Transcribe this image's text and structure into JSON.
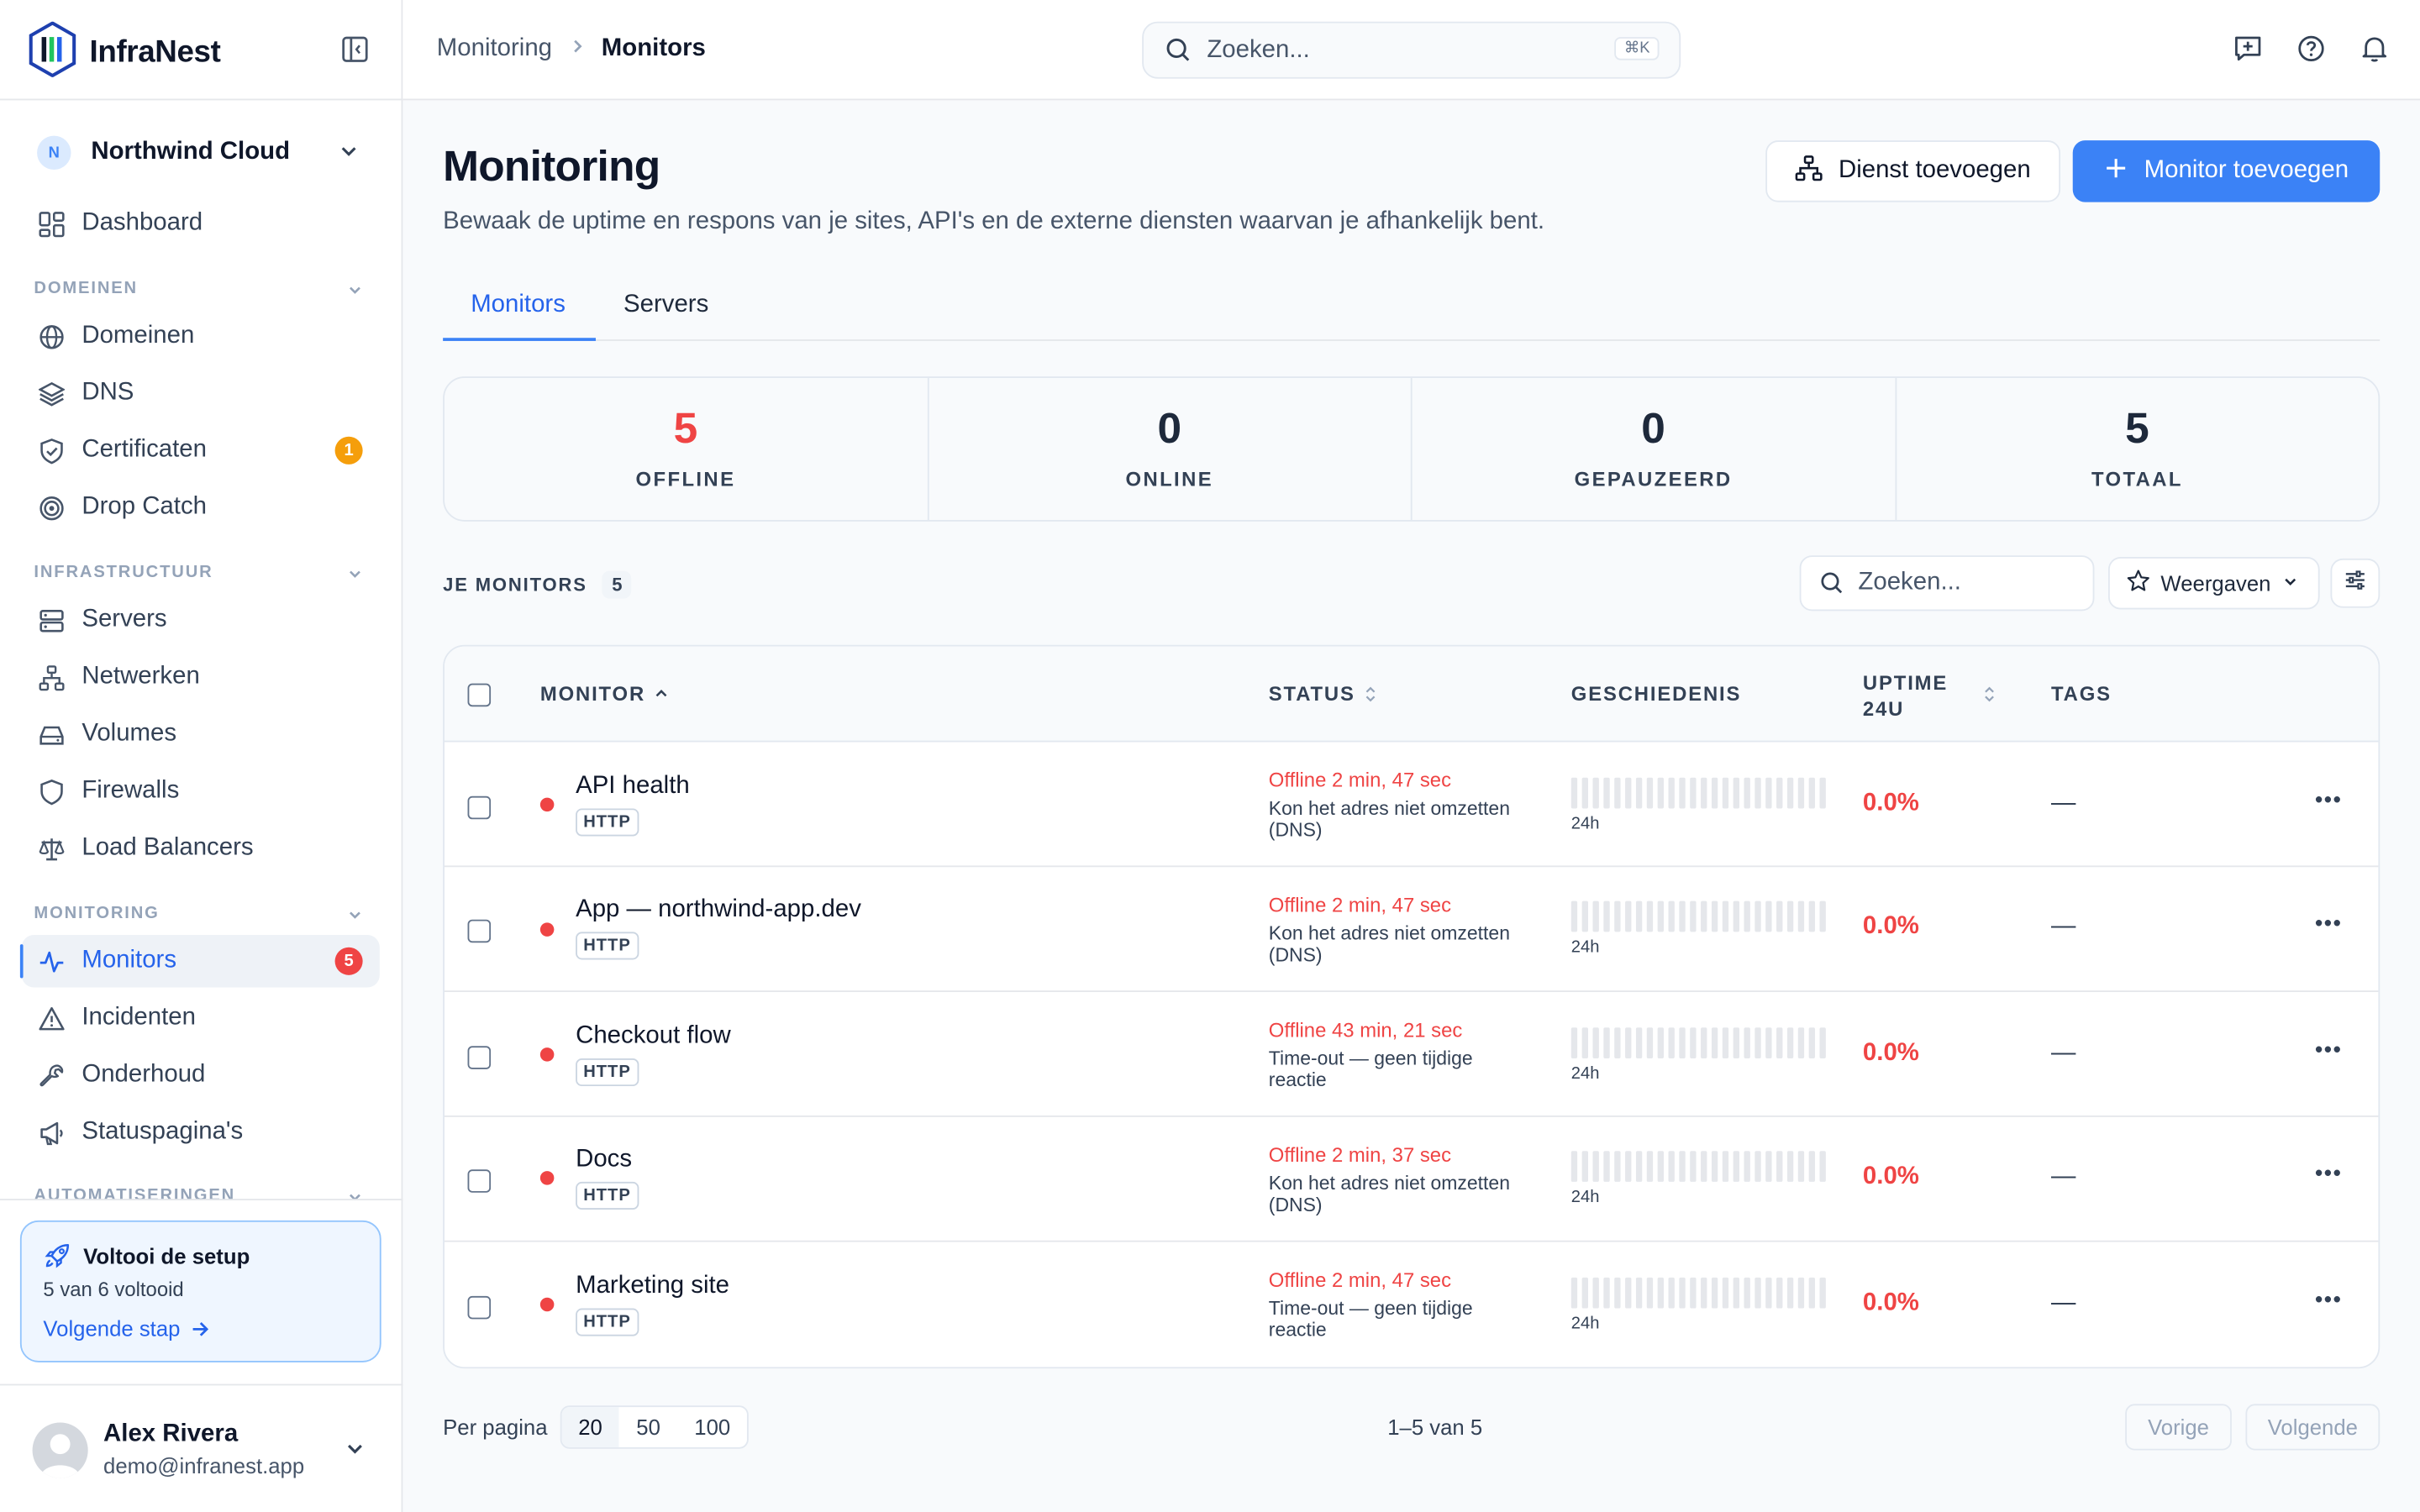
{
  "app": {
    "name": "InfraNest"
  },
  "workspace": {
    "initial": "N",
    "name": "Northwind Cloud"
  },
  "nav": {
    "dashboard": "Dashboard",
    "domains_section": "DOMEINEN",
    "domains": "Domeinen",
    "dns": "DNS",
    "certificates": "Certificaten",
    "certificates_badge": "1",
    "drop_catch": "Drop Catch",
    "infra_section": "INFRASTRUCTUUR",
    "servers": "Servers",
    "networks": "Netwerken",
    "volumes": "Volumes",
    "firewalls": "Firewalls",
    "load_balancers": "Load Balancers",
    "monitoring_section": "MONITORING",
    "monitors": "Monitors",
    "monitors_badge": "5",
    "incidents": "Incidenten",
    "maintenance": "Onderhoud",
    "status_pages": "Statuspagina's",
    "automations_section": "AUTOMATISERINGEN"
  },
  "setup": {
    "title": "Voltooi de setup",
    "progress": "5 van 6 voltooid",
    "next": "Volgende stap"
  },
  "user": {
    "name": "Alex Rivera",
    "email": "demo@infranest.app"
  },
  "topbar": {
    "breadcrumb": [
      "Monitoring",
      "Monitors"
    ],
    "search_placeholder": "Zoeken...",
    "search_shortcut": "⌘K"
  },
  "page": {
    "title": "Monitoring",
    "subtitle": "Bewaak de uptime en respons van je sites, API's en de externe diensten waarvan je afhankelijk bent.",
    "add_service": "Dienst toevoegen",
    "add_monitor": "Monitor toevoegen",
    "tabs": [
      "Monitors",
      "Servers"
    ]
  },
  "stats": [
    {
      "value": "5",
      "label": "OFFLINE",
      "color": "#ef4444"
    },
    {
      "value": "0",
      "label": "ONLINE",
      "color": "#1e293b"
    },
    {
      "value": "0",
      "label": "GEPAUZEERD",
      "color": "#1e293b"
    },
    {
      "value": "5",
      "label": "TOTAAL",
      "color": "#1e293b"
    }
  ],
  "list": {
    "title": "JE MONITORS",
    "count": "5",
    "search_placeholder": "Zoeken...",
    "views": "Weergaven"
  },
  "table": {
    "headers": {
      "monitor": "MONITOR",
      "status": "STATUS",
      "history": "GESCHIEDENIS",
      "uptime_1": "UPTIME",
      "uptime_2": "24U",
      "tags": "TAGS"
    },
    "rows": [
      {
        "name": "API health",
        "type": "HTTP",
        "status": "Offline 2 min, 47 sec",
        "reason": "Kon het adres niet omzetten (DNS)",
        "history_label": "24h",
        "uptime": "0.0%",
        "tags": "—",
        "status_color": "#ef4444"
      },
      {
        "name": "App — northwind-app.dev",
        "type": "HTTP",
        "status": "Offline 2 min, 47 sec",
        "reason": "Kon het adres niet omzetten (DNS)",
        "history_label": "24h",
        "uptime": "0.0%",
        "tags": "—",
        "status_color": "#ef4444"
      },
      {
        "name": "Checkout flow",
        "type": "HTTP",
        "status": "Offline 43 min, 21 sec",
        "reason": "Time-out — geen tijdige reactie",
        "history_label": "24h",
        "uptime": "0.0%",
        "tags": "—",
        "status_color": "#ef4444"
      },
      {
        "name": "Docs",
        "type": "HTTP",
        "status": "Offline 2 min, 37 sec",
        "reason": "Kon het adres niet omzetten (DNS)",
        "history_label": "24h",
        "uptime": "0.0%",
        "tags": "—",
        "status_color": "#ef4444"
      },
      {
        "name": "Marketing site",
        "type": "HTTP",
        "status": "Offline 2 min, 47 sec",
        "reason": "Time-out — geen tijdige reactie",
        "history_label": "24h",
        "uptime": "0.0%",
        "tags": "—",
        "status_color": "#ef4444"
      }
    ]
  },
  "pagination": {
    "per_page_label": "Per pagina",
    "options": [
      "20",
      "50",
      "100"
    ],
    "range": "1–5 van 5",
    "prev": "Vorige",
    "next": "Volgende"
  }
}
